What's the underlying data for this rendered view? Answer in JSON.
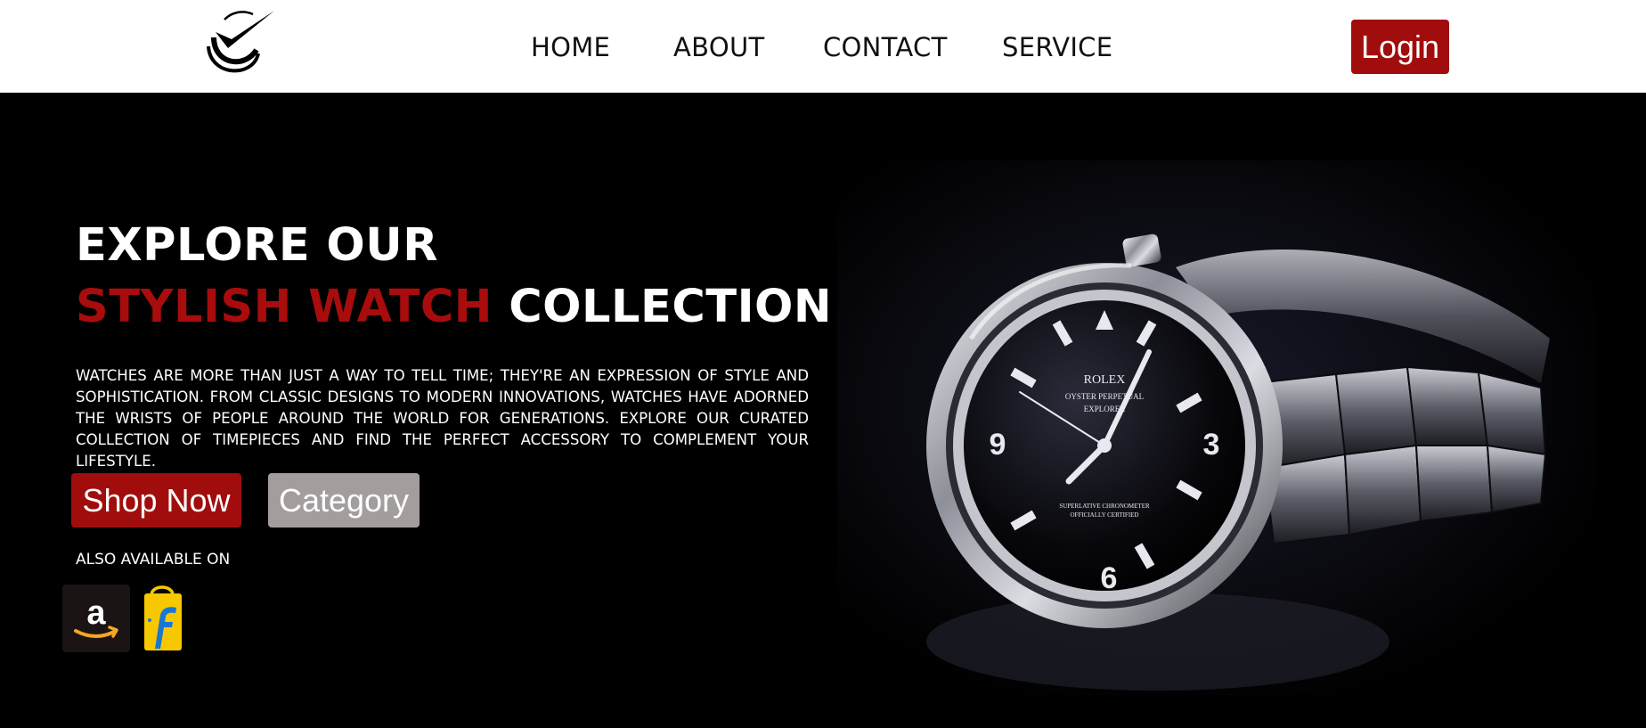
{
  "nav": {
    "logo_icon": "checkmark-logo-icon",
    "links": [
      {
        "label": "HOME"
      },
      {
        "label": "ABOUT"
      },
      {
        "label": "CONTACT"
      },
      {
        "label": "SERVICE"
      }
    ],
    "login_label": "Login"
  },
  "hero": {
    "title_line1": "EXPLORE OUR",
    "title_accent": "STYLISH WATCH",
    "title_rest": "COLLECTION",
    "description": "Watches are more than just a way to tell time; they're an expression of style and sophistication. From classic designs to modern innovations, watches have adorned the wrists of people around the world for generations. Explore our curated collection of timepieces and find the perfect accessory to complement your lifestyle.",
    "shop_label": "Shop Now",
    "category_label": "Category",
    "also_available": "ALSO AVAILABLE ON",
    "stores": [
      {
        "icon": "amazon-icon"
      },
      {
        "icon": "flipkart-icon"
      }
    ],
    "watch_image": {
      "brand": "ROLEX",
      "model": "OYSTER PERPETUAL",
      "sub": "EXPLORER",
      "dial_lines": [
        "SUPERLATIVE CHRONOMETER",
        "OFFICIALLY CERTIFIED"
      ],
      "numerals": [
        "3",
        "6",
        "9"
      ]
    }
  },
  "colors": {
    "accent": "#a10d0d",
    "category_btn": "#a49d9d",
    "nav_bg": "#ffffff",
    "hero_bg": "#000000"
  }
}
